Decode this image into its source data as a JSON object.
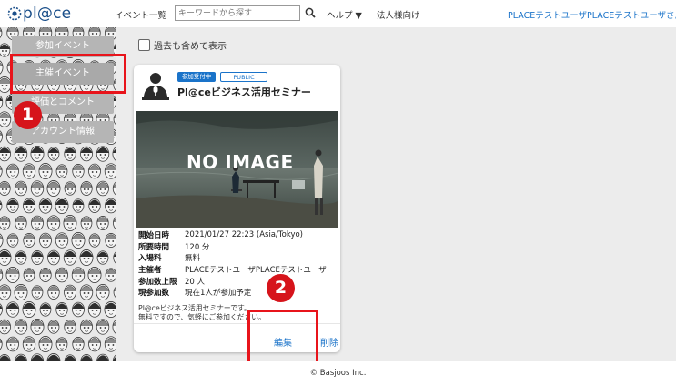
{
  "header": {
    "logo_text": "pl@ce",
    "nav_events": "イベント一覧",
    "search_placeholder": "キーワードから探す",
    "help": "ヘルプ ▼",
    "corporate": "法人様向け",
    "user": "PLACEテストユーザPLACEテストユーザさん"
  },
  "sidebar": {
    "items": [
      {
        "label": "参加イベント"
      },
      {
        "label": "主催イベント"
      },
      {
        "label": "評価とコメント"
      },
      {
        "label": "アカウント情報"
      }
    ]
  },
  "main": {
    "checkbox_label": "過去も含めて表示",
    "checkbox_checked": false
  },
  "card": {
    "status_badge": "参加受付中",
    "public_badge": "PUBLIC",
    "title": "Pl@ceビジネス活用セミナー",
    "image_text": "NO IMAGE",
    "rows": [
      {
        "label": "開始日時",
        "value": "2021/01/27 22:23 (Asia/Tokyo)"
      },
      {
        "label": "所要時間",
        "value": "120 分"
      },
      {
        "label": "入場料",
        "value": "無料"
      },
      {
        "label": "主催者",
        "value": "PLACEテストユーザPLACEテストユーザ"
      },
      {
        "label": "参加数上限",
        "value": "20 人"
      },
      {
        "label": "現参加数",
        "value": "現在1人が参加予定"
      }
    ],
    "description_line1": "Pl@ceビジネス活用セミナーです。",
    "description_line2": "無料ですので、気軽にご参加ください。",
    "edit": "編集",
    "delete": "削除"
  },
  "annotations": {
    "marker1": "1",
    "marker2": "2",
    "color": "#e8141b"
  },
  "footer": {
    "copyright": "© Basjoos Inc."
  }
}
